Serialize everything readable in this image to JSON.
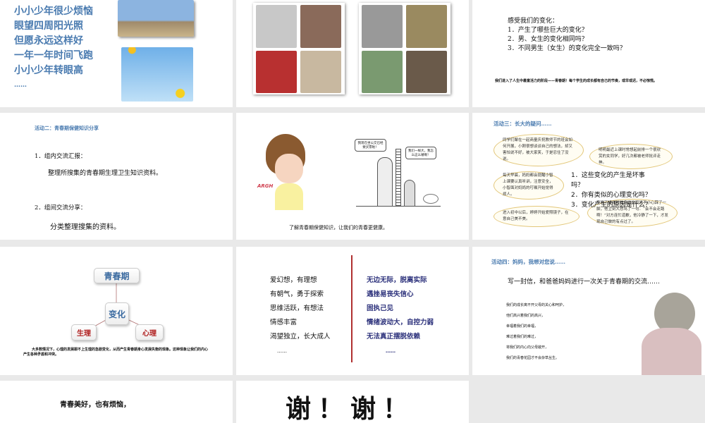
{
  "slides": [
    {
      "poem": [
        "小小少年很少烦恼",
        "眼望四周阳光照",
        "但愿永远这样好",
        "一年一年时间飞跑",
        "小小少年转眼高",
        "……"
      ]
    },
    {},
    {
      "heading": "感受我们的变化：",
      "items": [
        "1．产生了哪些巨大的变化？",
        "2．男、女生的变化相同吗？",
        "3．不同男生（女生）的变化完全一致吗？"
      ],
      "footer": "我们进入了人生中最富活力的阶段——青春期！每个学生的成长都有自己的节奏，或早或迟，不必惊慌。"
    },
    {
      "title": "活动二：青春期保健知识分享",
      "item1": "1．组内交流汇报：",
      "item1_detail": "整理所搜集的青春期生理卫生知识资料。",
      "item2": "2．组间交流分享：",
      "item2_detail": "分类整理搜集的资料。"
    },
    {
      "argh": "ARGH",
      "bubble_left": "我现在坐公交已经要买票啦！",
      "bubble_right": "我们一样大，我怎么这么矮啊！",
      "caption": "了解青春期保健知识，让我们的青春更健康。"
    },
    {
      "title": "活动三：长大的疑问……",
      "bubbles": [
        "同学们聚在一起商量庆祝教师节的班会如何开展，小刚很想谈谈自己的想法，却又害怕说不好，被大家笑，于是忍住了没说。",
        "明明最近上课时常想起前排一个很欣赏的女同学，好几次都被老师批评走神。",
        "每天早晨，妈妈都会提醒小智上课要认真听讲，注意安全，小智面对妈妈的叮嘱开始觉得烦人。",
        "进入初中以后，婷婷开始爱照镜子，在意自己美不美。",
        "李晓下楼梯时被身边的同学不小心踩了一脚，他立刻大怒骂了一句：“会不会走路啊！”对方连忙道歉，他冷静了一下，才发现自己做的有点过了。"
      ],
      "questions": [
        "1．这些变化的产生是坏事吗？",
        "2．你有类似的心理变化吗？",
        "3．变化产生的原因是什么？"
      ]
    },
    {
      "top": "青春期",
      "center": "变化",
      "left": "生理",
      "right": "心理",
      "caption": "大多数情况下，心理的发展跟不上生理的急剧变化，从而产生青春期身心发展失衡的现象。这种现象让我们的内心产生各种矛盾和冲突。"
    },
    {
      "left": [
        "爱幻想，有理想",
        "有朝气，勇于探索",
        "思维活跃，有想法",
        "情感丰富",
        "渴望独立，长大成人",
        "……"
      ],
      "right": [
        "无边无际，脱离实际",
        "遇挫易丧失信心",
        "固执己见",
        "情绪波动大，自控力弱",
        "无法真正摆脱依赖",
        "……"
      ]
    },
    {
      "title": "活动四：妈妈，我想对您说……",
      "subtitle": "写一封信，和爸爸妈妈进行一次关于青春期的交流……",
      "lines": [
        "我们的成长离不开父母的关心和呵护，",
        "他们高兴着我们的高兴，",
        "幸福着我们的幸福，",
        "难过着我们的难过，",
        "将我们的内心向父母敞开，",
        "我们的青春花园才不会杂草丛生。"
      ]
    },
    {
      "line1": "青春美好，也有烦恼，"
    },
    {
      "thanks": "谢！谢！"
    }
  ],
  "colors": {
    "accent_blue": "#4a7bb0",
    "divider_red": "#b03030",
    "navy": "#2a2f7a"
  }
}
